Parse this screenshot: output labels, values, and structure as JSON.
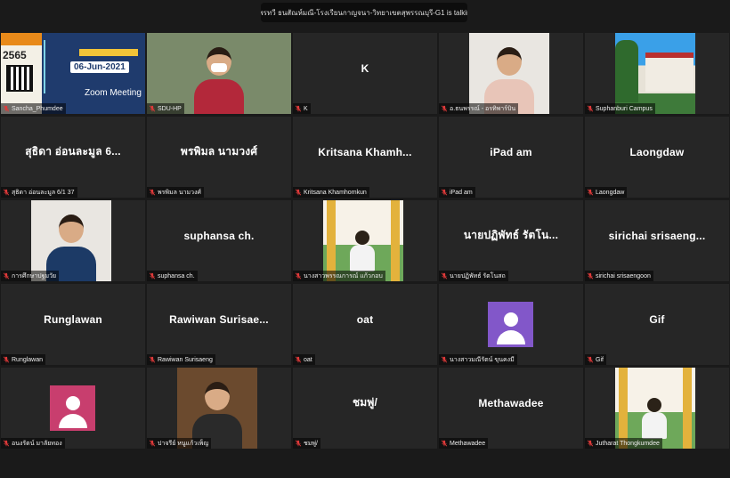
{
  "talking_indicator": "ผศ.พรทวี ธนสัณห์มณี-โรงเรียนกาญจนา-วิทยาเขตสุพรรณบุรี-G1 is talking...",
  "colors": {
    "background": "#1a1a1a",
    "tile": "#262626",
    "active_speaker": "#2ecc40",
    "muted_mic": "#e03a3a",
    "avatar_purple": "#8257c9",
    "avatar_pink": "#c83e6e"
  },
  "participants": [
    {
      "label": "Sancha_Phumdee",
      "display": "",
      "kind": "video-poster",
      "poster_year": "2565",
      "poster_date": "06-Jun-2021",
      "poster_app": "Zoom Meeting"
    },
    {
      "label": "SDU-HP",
      "display": "",
      "kind": "video-person",
      "active": true
    },
    {
      "label": "K",
      "display": "K",
      "kind": "name"
    },
    {
      "label": "อ.ธนพรรณ์ - อรทิพาร์บิน",
      "display": "",
      "kind": "video-person"
    },
    {
      "label": "Suphanburi Campus",
      "display": "",
      "kind": "video-building"
    },
    {
      "label": "สุธิดา อ่อนละมูล 6/1 37",
      "display": "สุธิดา อ่อนละมูล 6...",
      "kind": "name"
    },
    {
      "label": "พรพิมล นามวงศ์",
      "display": "พรพิมล นามวงศ์",
      "kind": "name"
    },
    {
      "label": "Kritsana Khamhomkun",
      "display": "Kritsana  Khamh...",
      "kind": "name"
    },
    {
      "label": "iPad am",
      "display": "iPad am",
      "kind": "name"
    },
    {
      "label": "Laongdaw",
      "display": "Laongdaw",
      "kind": "name"
    },
    {
      "label": "การศึกษาปฐมวัย",
      "display": "",
      "kind": "video-person"
    },
    {
      "label": "suphansa ch.",
      "display": "suphansa ch.",
      "kind": "name"
    },
    {
      "label": "นางสาวพรรณการณ์ แก้วกอบ",
      "display": "",
      "kind": "video-outdoor"
    },
    {
      "label": "นายปฏิพัทธ์ รัตโนสถ",
      "display": "นายปฏิพัทธ์ รัตโน...",
      "kind": "name"
    },
    {
      "label": "sirichai srisaengoon",
      "display": "sirichai srisaeng...",
      "kind": "name"
    },
    {
      "label": "Runglawan",
      "display": "Runglawan",
      "kind": "name"
    },
    {
      "label": "Rawiwan Surisaeng",
      "display": "Rawiwan Surisae...",
      "kind": "name"
    },
    {
      "label": "oat",
      "display": "oat",
      "kind": "name"
    },
    {
      "label": "นางสาวมณีรัตน์ ขุนคงมี",
      "display": "",
      "kind": "avatar",
      "avatar_color": "#8257c9"
    },
    {
      "label": "Gif",
      "display": "Gif",
      "kind": "name"
    },
    {
      "label": "อนงรัตน์ มาลัยทอง",
      "display": "",
      "kind": "avatar",
      "avatar_color": "#c83e6e"
    },
    {
      "label": "ปาจรีย์ หนูแก้วเพ็ญ",
      "display": "",
      "kind": "video-person"
    },
    {
      "label": "ชมพู่/",
      "display": "ชมพู่/",
      "kind": "name"
    },
    {
      "label": "Methawadee",
      "display": "Methawadee",
      "kind": "name"
    },
    {
      "label": "Jutharat Thongkumdee",
      "display": "",
      "kind": "video-outdoor"
    }
  ]
}
